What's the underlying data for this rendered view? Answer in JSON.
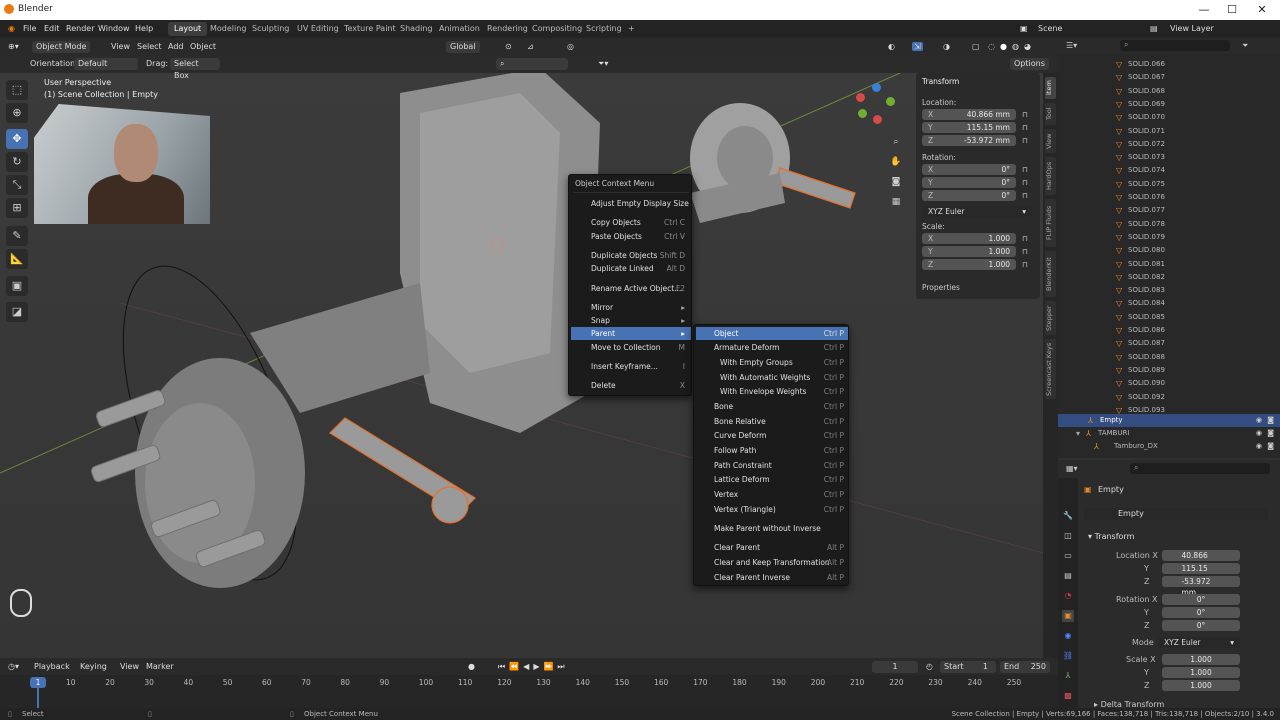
{
  "window": {
    "title": "Blender"
  },
  "topbar": {
    "menus": [
      "File",
      "Edit",
      "Render",
      "Window",
      "Help"
    ],
    "workspaces": [
      "Layout",
      "Modeling",
      "Sculpting",
      "UV Editing",
      "Texture Paint",
      "Shading",
      "Animation",
      "Rendering",
      "Compositing",
      "Scripting",
      "+"
    ],
    "active_workspace": "Layout",
    "scene": "Scene",
    "view_layer": "View Layer"
  },
  "viewport_header": {
    "mode": "Object Mode",
    "menus": [
      "View",
      "Select",
      "Add",
      "Object"
    ],
    "transform_orientation": "Global",
    "orientation_label": "Orientation:",
    "orientation_value": "Default",
    "drag_label": "Drag:",
    "drag_value": "Select Box",
    "options": "Options"
  },
  "viewport": {
    "perspective": "User Perspective",
    "collection": "(1) Scene Collection | Empty"
  },
  "context_menu": {
    "title": "Object Context Menu",
    "items": [
      {
        "label": "Adjust Empty Display Size",
        "shortcut": ""
      },
      {
        "label": "Copy Objects",
        "shortcut": "Ctrl C"
      },
      {
        "label": "Paste Objects",
        "shortcut": "Ctrl V"
      },
      {
        "label": "Duplicate Objects",
        "shortcut": "Shift D"
      },
      {
        "label": "Duplicate Linked",
        "shortcut": "Alt D"
      },
      {
        "label": "Rename Active Object...",
        "shortcut": "F2"
      },
      {
        "label": "Mirror",
        "shortcut": "▸"
      },
      {
        "label": "Snap",
        "shortcut": "▸"
      },
      {
        "label": "Parent",
        "shortcut": "▸"
      },
      {
        "label": "Move to Collection",
        "shortcut": "M"
      },
      {
        "label": "Insert Keyframe...",
        "shortcut": "I"
      },
      {
        "label": "Delete",
        "shortcut": "X"
      }
    ]
  },
  "parent_submenu": {
    "items": [
      {
        "label": "Object",
        "shortcut": "Ctrl P"
      },
      {
        "label": "Armature Deform",
        "shortcut": "Ctrl P"
      },
      {
        "label": "With Empty Groups",
        "shortcut": "Ctrl P"
      },
      {
        "label": "With Automatic Weights",
        "shortcut": "Ctrl P"
      },
      {
        "label": "With Envelope Weights",
        "shortcut": "Ctrl P"
      },
      {
        "label": "Bone",
        "shortcut": "Ctrl P"
      },
      {
        "label": "Bone Relative",
        "shortcut": "Ctrl P"
      },
      {
        "label": "Curve Deform",
        "shortcut": "Ctrl P"
      },
      {
        "label": "Follow Path",
        "shortcut": "Ctrl P"
      },
      {
        "label": "Path Constraint",
        "shortcut": "Ctrl P"
      },
      {
        "label": "Lattice Deform",
        "shortcut": "Ctrl P"
      },
      {
        "label": "Vertex",
        "shortcut": "Ctrl P"
      },
      {
        "label": "Vertex (Triangle)",
        "shortcut": "Ctrl P"
      },
      {
        "label": "Make Parent without Inverse",
        "shortcut": ""
      },
      {
        "label": "Clear Parent",
        "shortcut": "Alt P"
      },
      {
        "label": "Clear and Keep Transformation",
        "shortcut": "Alt P"
      },
      {
        "label": "Clear Parent Inverse",
        "shortcut": "Alt P"
      }
    ]
  },
  "npanel": {
    "title": "Transform",
    "location_label": "Location:",
    "location": {
      "x": "40.866 mm",
      "y": "115.15 mm",
      "z": "-53.972 mm"
    },
    "rotation_label": "Rotation:",
    "rotation": {
      "x": "0°",
      "y": "0°",
      "z": "0°"
    },
    "rotation_mode": "XYZ Euler",
    "scale_label": "Scale:",
    "scale": {
      "x": "1.000",
      "y": "1.000",
      "z": "1.000"
    },
    "properties": "Properties",
    "axis": {
      "x": "X",
      "y": "Y",
      "z": "Z"
    }
  },
  "side_tabs": [
    "Item",
    "Tool",
    "View",
    "HardOps",
    "FLIP Fluids",
    "BlenderKit",
    "Stepper",
    "Screencast Keys"
  ],
  "outliner": {
    "rows": [
      "SOLID.066",
      "SOLID.067",
      "SOLID.068",
      "SOLID.069",
      "SOLID.070",
      "SOLID.071",
      "SOLID.072",
      "SOLID.073",
      "SOLID.074",
      "SOLID.075",
      "SOLID.076",
      "SOLID.077",
      "SOLID.078",
      "SOLID.079",
      "SOLID.080",
      "SOLID.081",
      "SOLID.082",
      "SOLID.083",
      "SOLID.084",
      "SOLID.085",
      "SOLID.086",
      "SOLID.087",
      "SOLID.088",
      "SOLID.089",
      "SOLID.090",
      "SOLID.092",
      "SOLID.093"
    ],
    "selected": "Empty",
    "tamburi": "TAMBURI",
    "tamburo": "Tamburo_DX"
  },
  "properties": {
    "object_name": "Empty",
    "datablock": "Empty",
    "transform": "Transform",
    "location_x_label": "Location X",
    "rotation_x_label": "Rotation X",
    "scale_x_label": "Scale X",
    "y": "Y",
    "z": "Z",
    "location": [
      "40.866 mm",
      "115.15 mm",
      "-53.972 mm"
    ],
    "rotation": [
      "0°",
      "0°",
      "0°"
    ],
    "mode_label": "Mode",
    "mode": "XYZ Euler",
    "scale": [
      "1.000",
      "1.000",
      "1.000"
    ],
    "delta": "Delta Transform"
  },
  "timeline": {
    "menus": [
      "Playback",
      "Keying",
      "View",
      "Marker"
    ],
    "current_frame": "1",
    "start_label": "Start",
    "start": "1",
    "end_label": "End",
    "end": "250",
    "ticks": [
      "10",
      "20",
      "30",
      "40",
      "50",
      "60",
      "70",
      "80",
      "90",
      "100",
      "110",
      "120",
      "130",
      "140",
      "150",
      "160",
      "170",
      "180",
      "190",
      "200",
      "210",
      "220",
      "230",
      "240",
      "250"
    ],
    "playhead": "1"
  },
  "status": {
    "left": "Select",
    "middle": "Object Context Menu",
    "right": "Scene Collection | Empty | Verts:69,166 | Faces:138,718 | Tris:138,718 | Objects:2/10 | 3.4.0"
  }
}
